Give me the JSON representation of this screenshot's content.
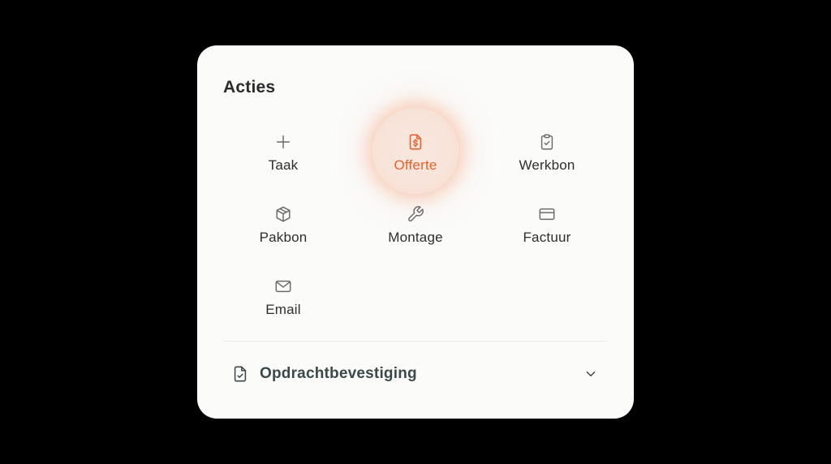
{
  "panel": {
    "title": "Acties"
  },
  "actions": [
    {
      "label": "Taak",
      "icon": "plus-icon"
    },
    {
      "label": "Offerte",
      "icon": "document-dollar-icon",
      "active": true
    },
    {
      "label": "Werkbon",
      "icon": "clipboard-check-icon"
    },
    {
      "label": "Pakbon",
      "icon": "package-icon"
    },
    {
      "label": "Montage",
      "icon": "wrench-icon"
    },
    {
      "label": "Factuur",
      "icon": "credit-card-icon"
    },
    {
      "label": "Email",
      "icon": "mail-icon"
    }
  ],
  "footer": {
    "label": "Opdrachtbevestiging",
    "icon": "document-check-icon",
    "chevron": "chevron-down-icon"
  },
  "colors": {
    "background": "#000000",
    "card": "#fbfbfa",
    "accent": "#e8612c",
    "icon": "#6b6b6b",
    "text": "#2e2e2e"
  }
}
